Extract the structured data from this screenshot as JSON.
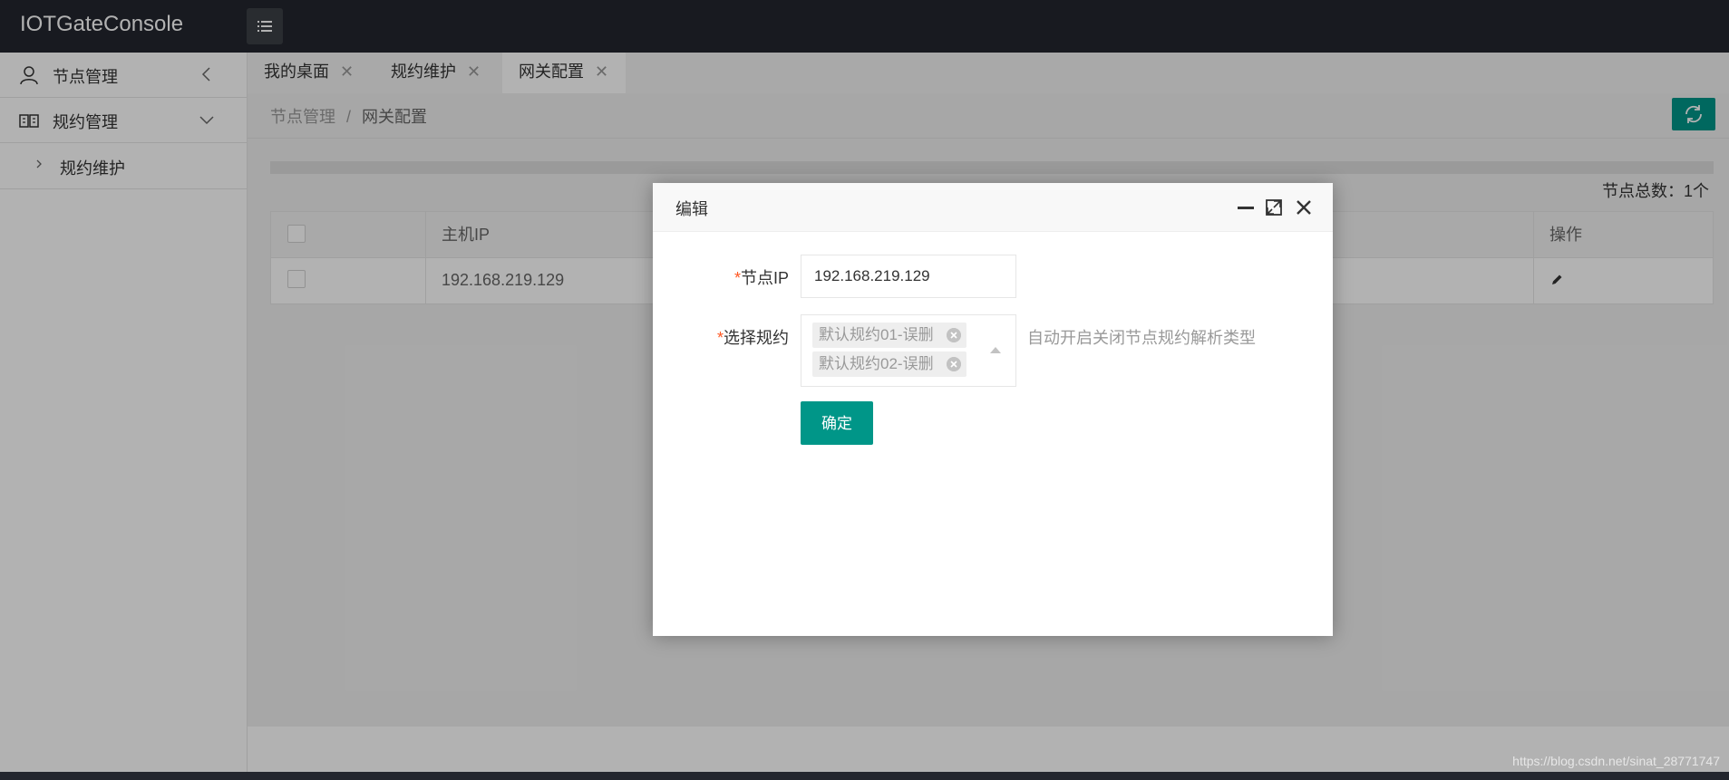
{
  "app": {
    "title": "IOTGateConsole"
  },
  "sidebar": {
    "items": [
      {
        "label": "节点管理"
      },
      {
        "label": "规约管理"
      }
    ],
    "sub_items": [
      {
        "label": "规约维护"
      }
    ]
  },
  "tabs": [
    {
      "label": "我的桌面",
      "close": "✕"
    },
    {
      "label": "规约维护",
      "close": "✕"
    },
    {
      "label": "网关配置",
      "close": "✕"
    }
  ],
  "breadcrumb": {
    "parent": "节点管理",
    "separator": "/",
    "current": "网关配置"
  },
  "summary": {
    "total": "节点总数：1个"
  },
  "table": {
    "columns": [
      "主机IP",
      "操作"
    ],
    "rows": [
      {
        "host_ip": "192.168.219.129"
      }
    ]
  },
  "dialog": {
    "title": "编辑",
    "fields": {
      "node_ip_required": "*",
      "node_ip_label": "节点IP",
      "node_ip_value": "192.168.219.129",
      "protocol_required": "*",
      "protocol_label": "选择规约",
      "selected_protocols": [
        "默认规约01-误删",
        "默认规约02-误删"
      ],
      "protocol_hint": "自动开启关闭节点规约解析类型"
    },
    "confirm_label": "确定"
  },
  "watermark": "https://blog.csdn.net/sinat_28771747",
  "colors": {
    "accent": "#009688",
    "header_bg": "#23262e",
    "required": "#ff5722"
  }
}
